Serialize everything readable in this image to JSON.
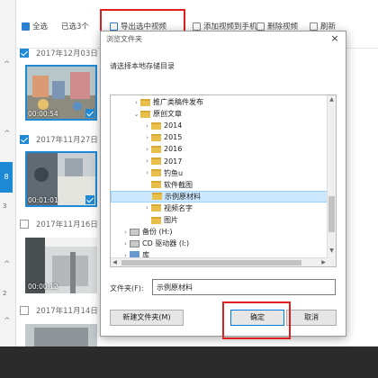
{
  "toolbar": {
    "select_all": "全选",
    "selected_count": "已选3个",
    "export_selected": "导出选中视频",
    "add_to_phone": "添加视频到手机",
    "delete_video": "删除视频",
    "refresh": "刷新"
  },
  "left_rail": {
    "marker_8": "8",
    "marker_3": "3",
    "marker_2": "2"
  },
  "groups": [
    {
      "date": "2017年12月03日",
      "checked": true,
      "thumbs": [
        {
          "duration": "00:00:54",
          "selected": true
        }
      ]
    },
    {
      "date": "2017年11月27日",
      "checked": true,
      "thumbs": [
        {
          "duration": "00:01:01",
          "selected": true
        }
      ]
    },
    {
      "date": "2017年11月16日",
      "checked": false,
      "thumbs": [
        {
          "duration": "00:00:12",
          "selected": false
        }
      ]
    },
    {
      "date": "2017年11月14日",
      "checked": false,
      "thumbs": []
    }
  ],
  "dialog": {
    "title": "浏览文件夹",
    "close_glyph": "×",
    "prompt": "请选择本地存储目录",
    "tree": [
      {
        "label": "推广类稿件发布",
        "expanded": false,
        "kind": "folder",
        "indent": 1
      },
      {
        "label": "原创文章",
        "expanded": true,
        "kind": "folder",
        "indent": 1
      },
      {
        "label": "2014",
        "expanded": false,
        "kind": "folder",
        "indent": 2
      },
      {
        "label": "2015",
        "expanded": false,
        "kind": "folder",
        "indent": 2
      },
      {
        "label": "2016",
        "expanded": false,
        "kind": "folder",
        "indent": 2
      },
      {
        "label": "2017",
        "expanded": false,
        "kind": "folder",
        "indent": 2
      },
      {
        "label": "钓鱼u",
        "expanded": false,
        "kind": "folder",
        "indent": 2
      },
      {
        "label": "软件截图",
        "expanded": null,
        "kind": "folder",
        "indent": 2
      },
      {
        "label": "示例原材料",
        "expanded": null,
        "kind": "folder",
        "indent": 2,
        "selected": true
      },
      {
        "label": "视频名字",
        "expanded": false,
        "kind": "folder",
        "indent": 2
      },
      {
        "label": "图片",
        "expanded": null,
        "kind": "folder",
        "indent": 2
      },
      {
        "label": "备份 (H:)",
        "expanded": false,
        "kind": "drive",
        "indent": 0
      },
      {
        "label": "CD 驱动器 (I:)",
        "expanded": false,
        "kind": "drive",
        "indent": 0
      },
      {
        "label": "库",
        "expanded": false,
        "kind": "library",
        "indent": 0
      }
    ],
    "folder_label": "文件夹(F):",
    "folder_value": "示例原材料",
    "new_folder_button": "新建文件夹(M)",
    "ok_button": "确定",
    "cancel_button": "取消"
  },
  "colors": {
    "accent": "#1e8ad6",
    "highlight_box": "#e02020",
    "tree_selected": "#cce8ff"
  }
}
